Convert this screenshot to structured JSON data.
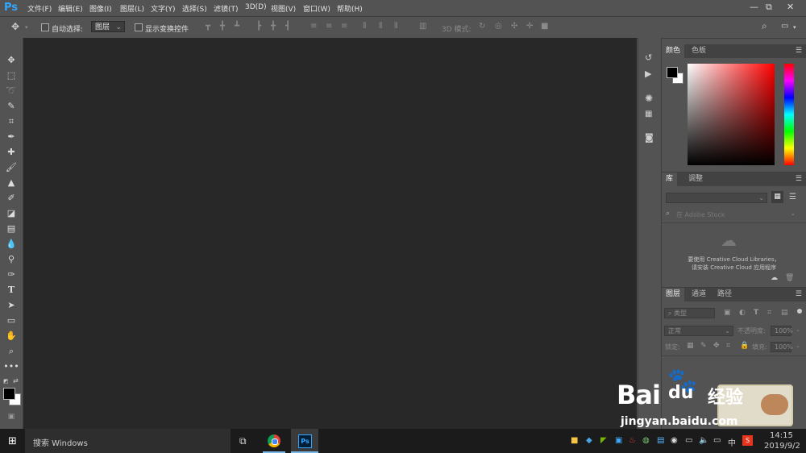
{
  "app": {
    "logo": "Ps"
  },
  "menu": [
    "文件(F)",
    "编辑(E)",
    "图像(I)",
    "图层(L)",
    "文字(Y)",
    "选择(S)",
    "滤镜(T)",
    "3D(D)",
    "视图(V)",
    "窗口(W)",
    "帮助(H)"
  ],
  "window_controls": {
    "minimize": "—",
    "restore": "⧉",
    "close": "✕"
  },
  "options_bar": {
    "auto_select_label": "自动选择:",
    "auto_select_value": "图层",
    "show_transform_label": "显示变换控件",
    "mode_3d_label": "3D 模式:"
  },
  "tools": [
    "move",
    "marquee",
    "lasso",
    "quick-select",
    "crop",
    "eyedropper",
    "healing",
    "brush",
    "stamp",
    "history-brush",
    "eraser",
    "gradient",
    "blur",
    "dodge",
    "pen",
    "type",
    "path-select",
    "rectangle",
    "hand",
    "zoom",
    "more"
  ],
  "color_panel": {
    "tabs": [
      "颜色",
      "色板"
    ]
  },
  "library_panel": {
    "tabs": [
      "库",
      "调整"
    ],
    "search_placeholder": "在 Adobe Stock",
    "message_line1": "要使用 Creative Cloud Libraries，",
    "message_line2": "请安装 Creative Cloud 应用程序"
  },
  "layers_panel": {
    "tabs": [
      "图层",
      "通道",
      "路径"
    ],
    "kind_label": "类型",
    "blend_mode": "正常",
    "opacity_label": "不透明度:",
    "opacity_value": "100%",
    "lock_label": "锁定:",
    "fill_label": "填充:",
    "fill_value": "100%"
  },
  "taskbar": {
    "search_text": "搜索 Windows",
    "time": "14:15",
    "date": "2019/9/2",
    "ime": "中"
  },
  "watermark": {
    "brand_left": "Bai",
    "brand_right": "du",
    "brand_cn": "经验",
    "url": "jingyan.baidu.com"
  },
  "colors": {
    "canvas": "#282828",
    "panel": "#535353",
    "accent": "#31a8ff",
    "taskbar": "#1b1b1b"
  }
}
